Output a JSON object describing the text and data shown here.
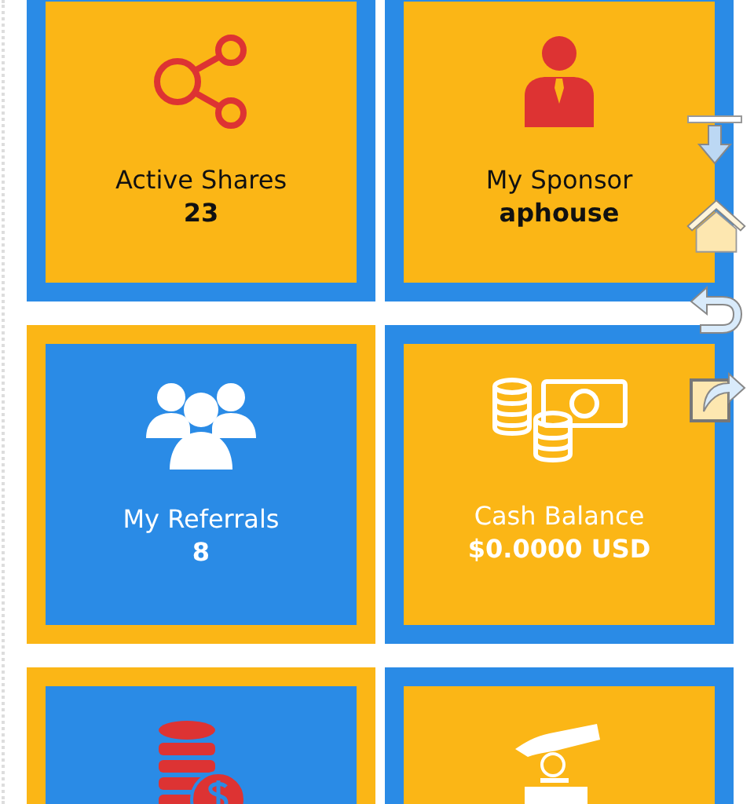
{
  "tiles": [
    {
      "kind": "blue-frame",
      "label": "Active Shares",
      "value": "23"
    },
    {
      "kind": "blue-frame",
      "label": "My Sponsor",
      "value": "aphouse"
    },
    {
      "kind": "yellow-frame",
      "label": "My Referrals",
      "value": "8"
    },
    {
      "kind": "blue-frame",
      "label": "Cash Balance",
      "value": "$0.0000 USD"
    },
    {
      "kind": "yellow-frame"
    },
    {
      "kind": "blue-frame"
    }
  ]
}
